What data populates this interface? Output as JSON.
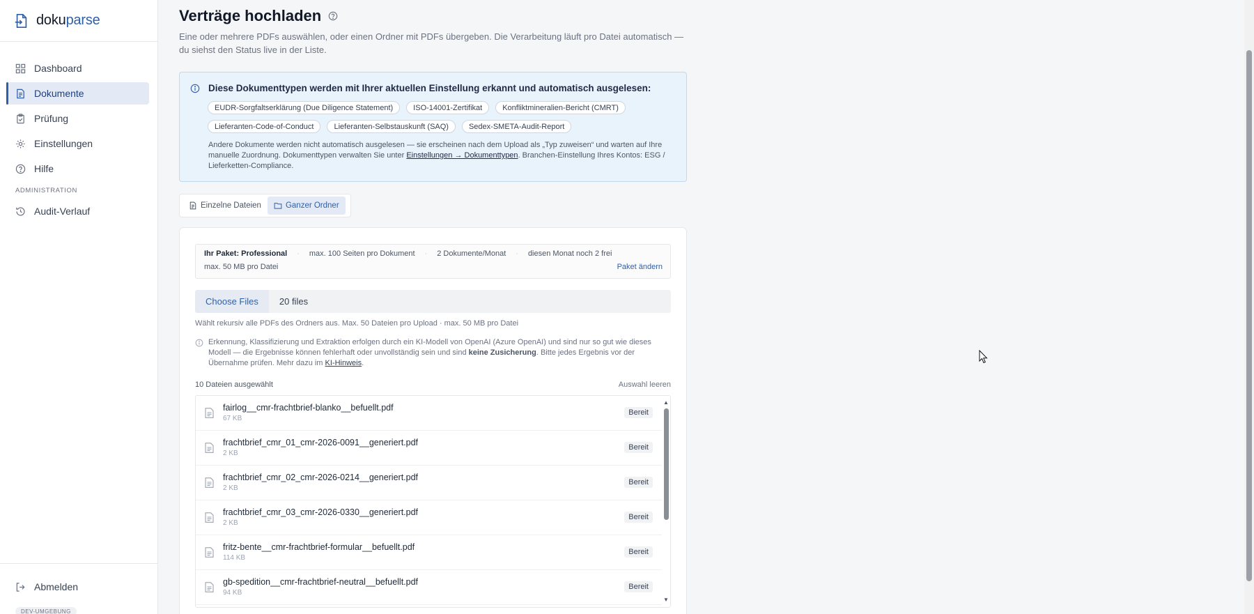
{
  "brand": {
    "name_prefix": "doku",
    "name_suffix": "parse"
  },
  "sidebar": {
    "items": [
      {
        "label": "Dashboard",
        "icon": "grid-icon"
      },
      {
        "label": "Dokumente",
        "icon": "document-icon",
        "active": true
      },
      {
        "label": "Prüfung",
        "icon": "clipboard-check-icon"
      },
      {
        "label": "Einstellungen",
        "icon": "gear-icon"
      },
      {
        "label": "Hilfe",
        "icon": "help-icon"
      }
    ],
    "section_label": "ADMINISTRATION",
    "admin_items": [
      {
        "label": "Audit-Verlauf",
        "icon": "history-icon"
      }
    ],
    "logout_label": "Abmelden",
    "env_badge": "DEV-UMGEBUNG"
  },
  "page": {
    "title": "Verträge hochladen",
    "subtitle": "Eine oder mehrere PDFs auswählen, oder einen Ordner mit PDFs übergeben. Die Verarbeitung läuft pro Datei automatisch — du siehst den Status live in der Liste."
  },
  "info": {
    "title": "Diese Dokumenttypen werden mit Ihrer aktuellen Einstellung erkannt und automatisch ausgelesen:",
    "chips_row1": [
      "EUDR-Sorgfaltserklärung (Due Diligence Statement)",
      "ISO-14001-Zertifikat",
      "Konfliktmineralien-Bericht (CMRT)"
    ],
    "chips_row2": [
      "Lieferanten-Code-of-Conduct",
      "Lieferanten-Selbstauskunft (SAQ)",
      "Sedex-SMETA-Audit-Report"
    ],
    "note_before": "Andere Dokumente werden nicht automatisch ausgelesen — sie erscheinen nach dem Upload als „Typ zuweisen“ und warten auf Ihre manuelle Zuordnung. Dokumenttypen verwalten Sie unter ",
    "note_link": "Einstellungen → Dokumenttypen",
    "note_after": ". Branchen-Einstellung Ihres Kontos: ESG / Lieferketten-Compliance."
  },
  "mode_tabs": {
    "single": "Einzelne Dateien",
    "folder": "Ganzer Ordner"
  },
  "plan": {
    "label": "Ihr Paket: Professional",
    "pages": "max. 100 Seiten pro Dokument",
    "docs": "2 Dokumente/Monat",
    "remaining": "diesen Monat noch 2 frei",
    "size": "max. 50 MB pro Datei",
    "change_link": "Paket ändern"
  },
  "upload": {
    "choose_label": "Choose Files",
    "file_count": "20 files",
    "hint": "Wählt rekursiv alle PDFs des Ordners aus. Max. 50 Dateien pro Upload · max. 50 MB pro Datei"
  },
  "ai_note": {
    "text_before": "Erkennung, Klassifizierung und Extraktion erfolgen durch ein KI-Modell von OpenAI (Azure OpenAI) und sind nur so gut wie dieses Modell — die Ergebnisse können fehlerhaft oder unvollständig sein und sind ",
    "bold": "keine Zusicherung",
    "text_middle": ". Bitte jedes Ergebnis vor der Übernahme prüfen. Mehr dazu im ",
    "link": "KI-Hinweis",
    "text_after": "."
  },
  "selection": {
    "count": "10 Dateien ausgewählt",
    "clear": "Auswahl leeren"
  },
  "files": [
    {
      "name": "fairlog__cmr-frachtbrief-blanko__befuellt.pdf",
      "size": "67 KB",
      "status": "Bereit"
    },
    {
      "name": "frachtbrief_cmr_01_cmr-2026-0091__generiert.pdf",
      "size": "2 KB",
      "status": "Bereit"
    },
    {
      "name": "frachtbrief_cmr_02_cmr-2026-0214__generiert.pdf",
      "size": "2 KB",
      "status": "Bereit"
    },
    {
      "name": "frachtbrief_cmr_03_cmr-2026-0330__generiert.pdf",
      "size": "2 KB",
      "status": "Bereit"
    },
    {
      "name": "fritz-bente__cmr-frachtbrief-formular__befuellt.pdf",
      "size": "114 KB",
      "status": "Bereit"
    },
    {
      "name": "gb-spedition__cmr-frachtbrief-neutral__befuellt.pdf",
      "size": "94 KB",
      "status": "Bereit"
    }
  ],
  "colors": {
    "accent": "#2f5fa7",
    "active_bg": "#e3e9f5",
    "info_bg": "#e9f3fc"
  }
}
